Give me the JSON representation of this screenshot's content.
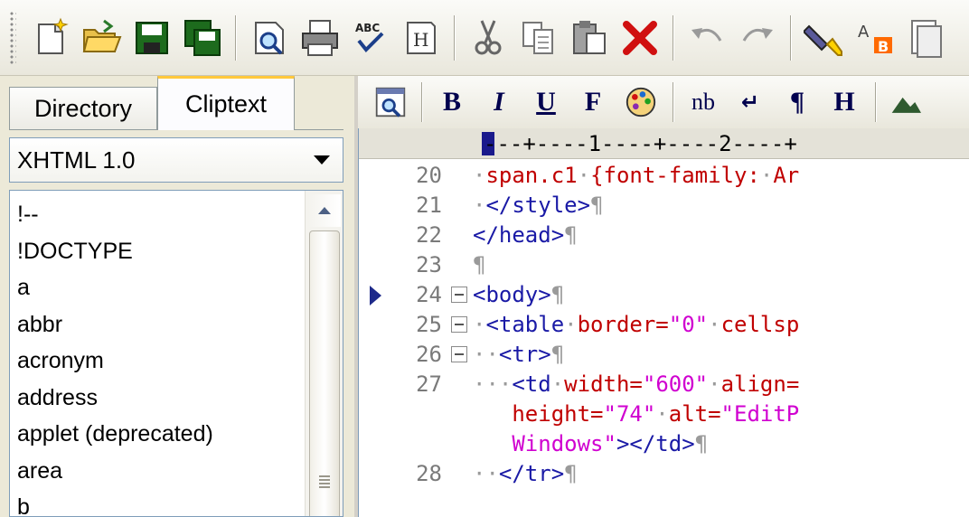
{
  "toolbar": {
    "icons": [
      "new-file-icon",
      "open-folder-icon",
      "save-icon",
      "save-all-icon",
      "print-preview-icon",
      "print-icon",
      "spell-check-icon",
      "html-toolbar-icon",
      "cut-icon",
      "copy-icon",
      "paste-icon",
      "delete-icon",
      "undo-icon",
      "redo-icon",
      "highlight-icon",
      "replace-icon",
      "clipboard-icon"
    ]
  },
  "tabs": {
    "directory": "Directory",
    "cliptext": "Cliptext"
  },
  "cliptext": {
    "selected": "XHTML 1.0",
    "items": [
      "!--",
      "!DOCTYPE",
      "a",
      "abbr",
      "acronym",
      "address",
      "applet (deprecated)",
      "area",
      "b"
    ]
  },
  "format_bar": {
    "bold": "B",
    "italic": "I",
    "underline": "U",
    "font": "F",
    "nbsp": "nb",
    "linebreak": "↵",
    "paragraph": "¶",
    "heading": "H"
  },
  "ruler": {
    "text": "---+----1----+----2----+"
  },
  "editor": {
    "lines": [
      {
        "num": "20",
        "fold": false,
        "marker": false,
        "parts": [
          {
            "t": "·",
            "c": "dot"
          },
          {
            "t": "span.c1",
            "c": "red"
          },
          {
            "t": "·",
            "c": "dot"
          },
          {
            "t": "{font-family:",
            "c": "red"
          },
          {
            "t": "·",
            "c": "dot"
          },
          {
            "t": "Ar",
            "c": "red"
          }
        ]
      },
      {
        "num": "21",
        "fold": false,
        "marker": false,
        "parts": [
          {
            "t": "·",
            "c": "dot"
          },
          {
            "t": "</style>",
            "c": "blue"
          },
          {
            "t": "¶",
            "c": "dot"
          }
        ]
      },
      {
        "num": "22",
        "fold": false,
        "marker": false,
        "parts": [
          {
            "t": "</head>",
            "c": "blue"
          },
          {
            "t": "¶",
            "c": "dot"
          }
        ]
      },
      {
        "num": "23",
        "fold": false,
        "marker": false,
        "parts": [
          {
            "t": "¶",
            "c": "dot"
          }
        ]
      },
      {
        "num": "24",
        "fold": true,
        "marker": true,
        "parts": [
          {
            "t": "<body>",
            "c": "blue"
          },
          {
            "t": "¶",
            "c": "dot"
          }
        ]
      },
      {
        "num": "25",
        "fold": true,
        "marker": false,
        "parts": [
          {
            "t": "·",
            "c": "dot"
          },
          {
            "t": "<table",
            "c": "blue"
          },
          {
            "t": "·",
            "c": "dot"
          },
          {
            "t": "border=",
            "c": "red"
          },
          {
            "t": "\"0\"",
            "c": "mag"
          },
          {
            "t": "·",
            "c": "dot"
          },
          {
            "t": "cellsp",
            "c": "red"
          }
        ]
      },
      {
        "num": "26",
        "fold": true,
        "marker": false,
        "parts": [
          {
            "t": "··",
            "c": "dot"
          },
          {
            "t": "<tr>",
            "c": "blue"
          },
          {
            "t": "¶",
            "c": "dot"
          }
        ]
      },
      {
        "num": "27",
        "fold": false,
        "marker": false,
        "parts": [
          {
            "t": "···",
            "c": "dot"
          },
          {
            "t": "<td",
            "c": "blue"
          },
          {
            "t": "·",
            "c": "dot"
          },
          {
            "t": "width=",
            "c": "red"
          },
          {
            "t": "\"600\"",
            "c": "mag"
          },
          {
            "t": "·",
            "c": "dot"
          },
          {
            "t": "align=",
            "c": "red"
          }
        ]
      },
      {
        "num": "",
        "fold": false,
        "marker": false,
        "parts": [
          {
            "t": "   height=",
            "c": "red"
          },
          {
            "t": "\"74\"",
            "c": "mag"
          },
          {
            "t": "·",
            "c": "dot"
          },
          {
            "t": "alt=",
            "c": "red"
          },
          {
            "t": "\"EditP",
            "c": "mag"
          }
        ]
      },
      {
        "num": "",
        "fold": false,
        "marker": false,
        "parts": [
          {
            "t": "   Windows\"",
            "c": "mag"
          },
          {
            "t": "></td>",
            "c": "blue"
          },
          {
            "t": "¶",
            "c": "dot"
          }
        ]
      },
      {
        "num": "28",
        "fold": false,
        "marker": false,
        "parts": [
          {
            "t": "··",
            "c": "dot"
          },
          {
            "t": "</tr>",
            "c": "blue"
          },
          {
            "t": "¶",
            "c": "dot"
          }
        ]
      }
    ]
  }
}
